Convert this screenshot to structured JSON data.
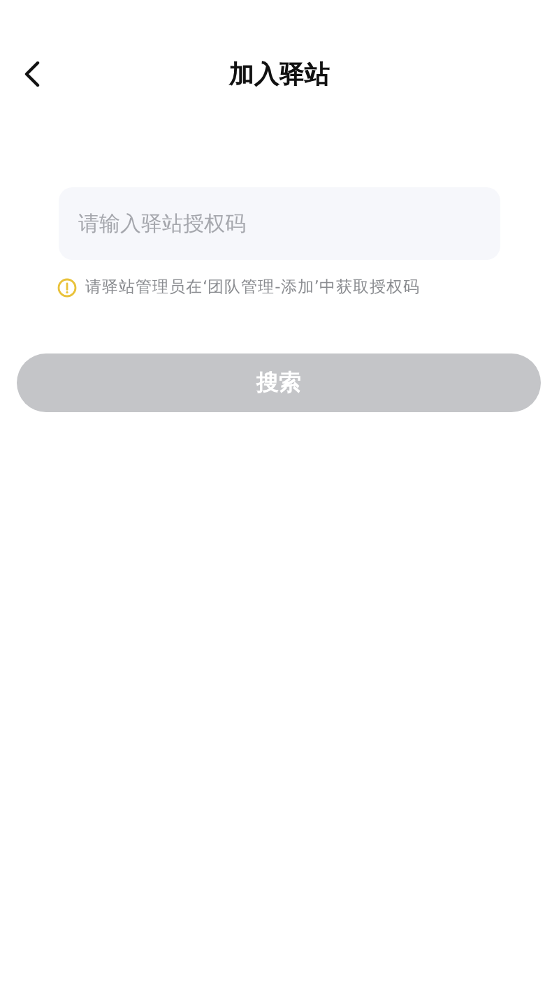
{
  "header": {
    "title": "加入驿站"
  },
  "code_field": {
    "placeholder": "请输入驿站授权码"
  },
  "hint": {
    "text": "请驿站管理员在‘团队管理-添加’中获取授权码"
  },
  "search_button": {
    "label": "搜索",
    "disabled": true
  }
}
